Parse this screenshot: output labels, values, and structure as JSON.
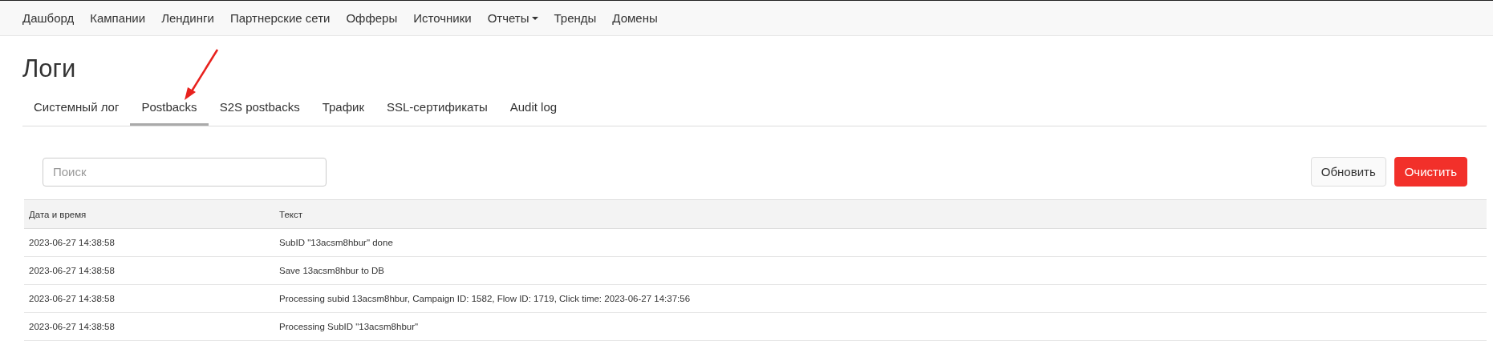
{
  "navbar": {
    "items": [
      {
        "label": "Дашборд",
        "dropdown": false
      },
      {
        "label": "Кампании",
        "dropdown": false
      },
      {
        "label": "Лендинги",
        "dropdown": false
      },
      {
        "label": "Партнерские сети",
        "dropdown": false
      },
      {
        "label": "Офферы",
        "dropdown": false
      },
      {
        "label": "Источники",
        "dropdown": false
      },
      {
        "label": "Отчеты",
        "dropdown": true
      },
      {
        "label": "Тренды",
        "dropdown": false
      },
      {
        "label": "Домены",
        "dropdown": false
      }
    ]
  },
  "page": {
    "title": "Логи"
  },
  "tabs": [
    {
      "label": "Системный лог",
      "selected": false
    },
    {
      "label": "Postbacks",
      "selected": true
    },
    {
      "label": "S2S postbacks",
      "selected": false
    },
    {
      "label": "Трафик",
      "selected": false
    },
    {
      "label": "SSL-сертификаты",
      "selected": false
    },
    {
      "label": "Audit log",
      "selected": false
    }
  ],
  "search": {
    "placeholder": "Поиск"
  },
  "buttons": [
    {
      "label": "Обновить",
      "kind": "default"
    },
    {
      "label": "Очистить",
      "kind": "danger"
    }
  ],
  "table": {
    "columns": [
      "Дата и время",
      "Текст"
    ],
    "rows": [
      [
        "2023-06-27 14:38:58",
        "SubID \"13acsm8hbur\" done"
      ],
      [
        "2023-06-27 14:38:58",
        "Save 13acsm8hbur to DB"
      ],
      [
        "2023-06-27 14:38:58",
        "Processing subid 13acsm8hbur, Campaign ID: 1582, Flow ID: 1719, Click time: 2023-06-27 14:37:56"
      ],
      [
        "2023-06-27 14:38:58",
        "Processing SubID \"13acsm8hbur\""
      ]
    ]
  }
}
